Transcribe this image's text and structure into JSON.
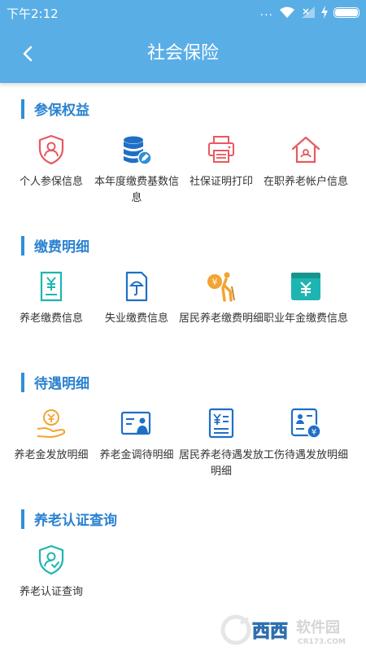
{
  "status_bar": {
    "time": "下午2:12",
    "dots": "..."
  },
  "header": {
    "title": "社会保险"
  },
  "sections": [
    {
      "title": "参保权益",
      "items": [
        {
          "label": "个人参保信息",
          "icon": "shield-person-icon"
        },
        {
          "label": "本年度缴费基数信息",
          "icon": "database-edit-icon"
        },
        {
          "label": "社保证明打印",
          "icon": "printer-icon"
        },
        {
          "label": "在职养老帐户信息",
          "icon": "house-account-icon"
        }
      ]
    },
    {
      "title": "缴费明细",
      "items": [
        {
          "label": "养老缴费信息",
          "icon": "yuan-document-icon"
        },
        {
          "label": "失业缴费信息",
          "icon": "umbrella-document-icon"
        },
        {
          "label": "居民养老缴费明细",
          "icon": "elderly-person-icon"
        },
        {
          "label": "职业年金缴费信息",
          "icon": "yuan-card-icon"
        }
      ]
    },
    {
      "title": "待遇明细",
      "items": [
        {
          "label": "养老金发放明细",
          "icon": "hand-coin-icon"
        },
        {
          "label": "养老金调待明细",
          "icon": "id-card-icon"
        },
        {
          "label": "居民养老待遇发放明细",
          "icon": "yuan-list-icon"
        },
        {
          "label": "工伤待遇发放明细",
          "icon": "injury-doc-icon"
        }
      ]
    },
    {
      "title": "养老认证查询",
      "items": [
        {
          "label": "养老认证查询",
          "icon": "shield-check-icon"
        }
      ]
    }
  ],
  "watermark": {
    "brand": "西西",
    "cn_text": "软件园",
    "url": "CR173.COM"
  },
  "colors": {
    "primary": "#5aaee6",
    "section_title": "#2a82d0",
    "accent_red": "#e8595f",
    "accent_orange": "#f3a431",
    "accent_teal": "#1db5b1"
  }
}
